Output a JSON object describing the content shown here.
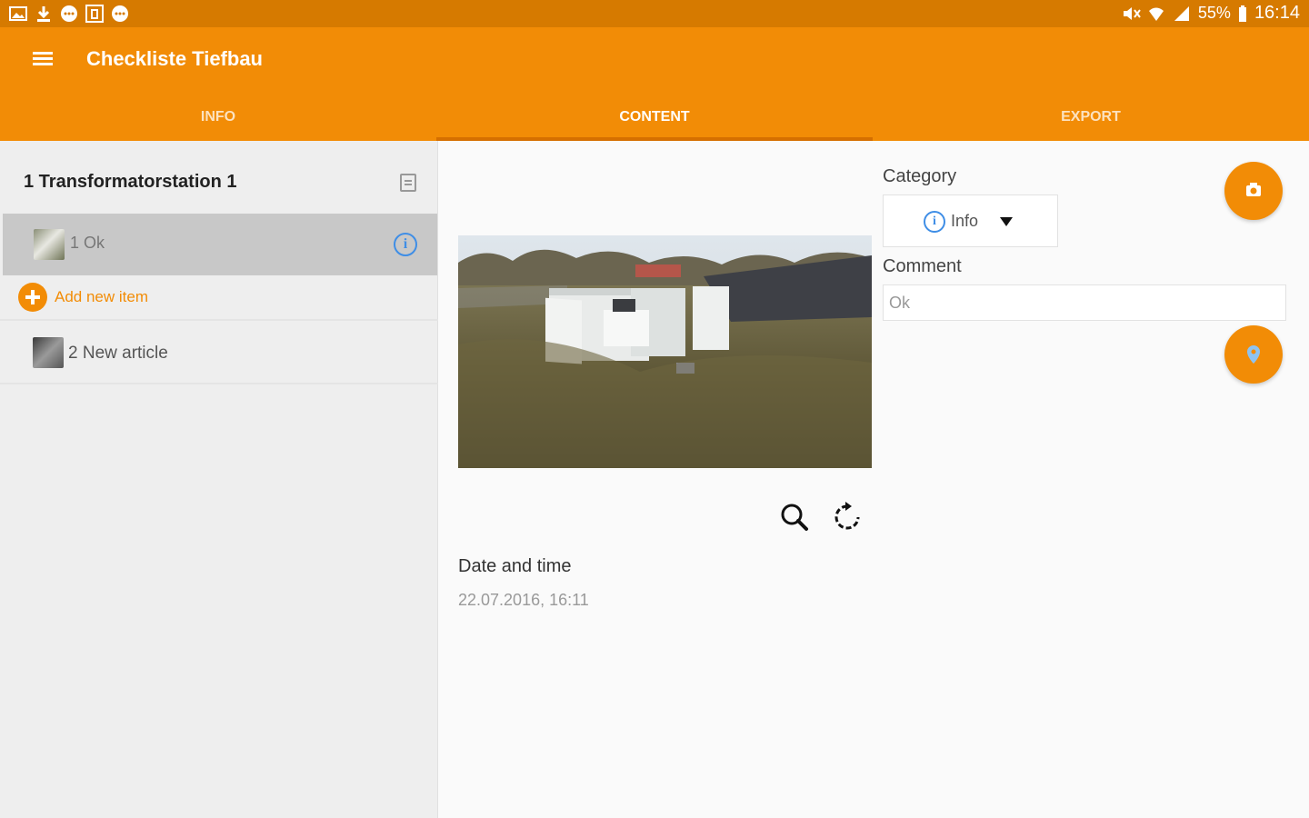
{
  "status_bar": {
    "battery": "55%",
    "time": "16:14"
  },
  "app_bar": {
    "title": "Checkliste Tiefbau",
    "tabs": [
      {
        "label": "INFO",
        "active": false
      },
      {
        "label": "CONTENT",
        "active": true
      },
      {
        "label": "EXPORT",
        "active": false
      }
    ]
  },
  "sidebar": {
    "section": {
      "title": "1  Transformatorstation 1"
    },
    "items": [
      {
        "label": "1  Ok",
        "selected": true
      },
      {
        "label": "2  New article",
        "selected": false
      }
    ],
    "add_label": "Add new item"
  },
  "content": {
    "date_label": "Date and time",
    "date_value": "22.07.2016, 16:11",
    "category_label": "Category",
    "category_value": "Info",
    "comment_label": "Comment",
    "comment_value": "Ok"
  },
  "colors": {
    "accent": "#f28c06",
    "status_bar": "#d67a00",
    "info_blue": "#3f8ee6"
  }
}
